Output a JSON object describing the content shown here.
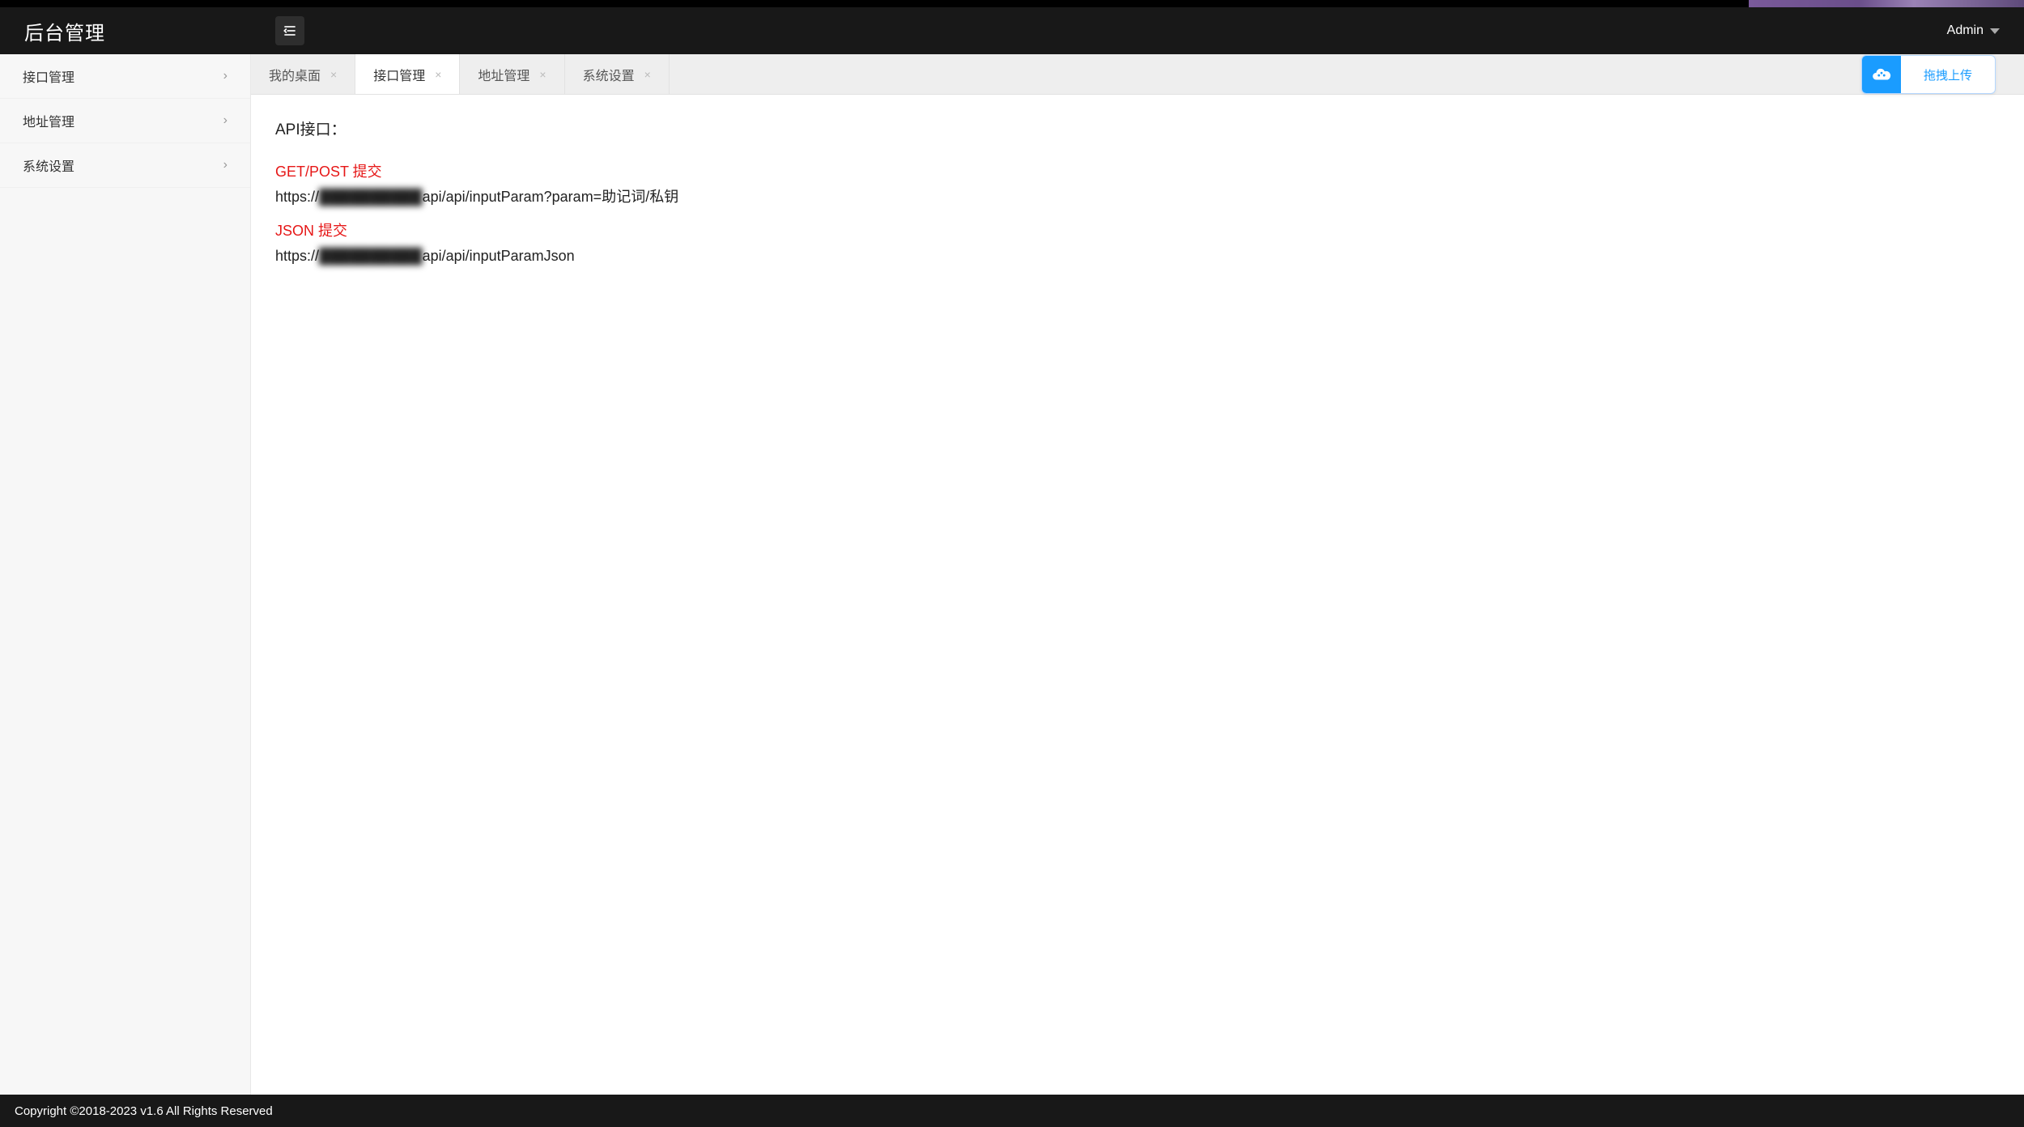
{
  "header": {
    "brand": "后台管理",
    "user": "Admin"
  },
  "sidebar": {
    "items": [
      {
        "label": "接口管理"
      },
      {
        "label": "地址管理"
      },
      {
        "label": "系统设置"
      }
    ]
  },
  "tabs": [
    {
      "label": "我的桌面",
      "closable": true,
      "active": false
    },
    {
      "label": "接口管理",
      "closable": true,
      "active": true
    },
    {
      "label": "地址管理",
      "closable": true,
      "active": false
    },
    {
      "label": "系统设置",
      "closable": true,
      "active": false
    }
  ],
  "content": {
    "api_heading": "API接口：",
    "section1_label": "GET/POST 提交",
    "section1_url_prefix": "https://",
    "section1_url_masked": "██████████",
    "section1_url_suffix": "api/api/inputParam?param=助记词/私钥",
    "section2_label": "JSON 提交",
    "section2_url_prefix": "https://",
    "section2_url_masked": "██████████",
    "section2_url_suffix": "api/api/inputParamJson"
  },
  "upload": {
    "label": "拖拽上传"
  },
  "footer": {
    "text": "Copyright ©2018-2023 v1.6 All Rights Reserved"
  }
}
